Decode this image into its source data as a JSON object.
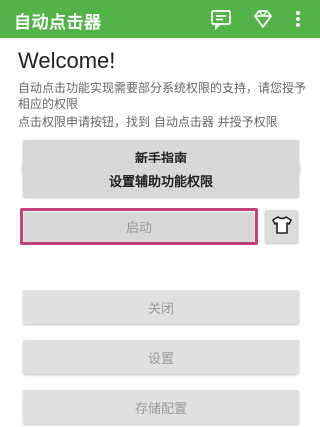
{
  "appbar": {
    "title": "自动点击器",
    "icons": [
      "message-icon",
      "diamond-icon",
      "more-vert-icon"
    ],
    "color": "#53b348"
  },
  "main": {
    "welcome": "Welcome!",
    "description_1": "自动点击功能实现需要部分系统权限的支持，请您授予相应的权限",
    "description_2": "点击权限申请按钮，找到 自动点击器 并授予权限",
    "buttons": {
      "guide": "新手指南",
      "accessibility": "设置辅助功能权限",
      "start": "启动",
      "close": "关闭",
      "settings": "设置",
      "storage": "存储配置"
    },
    "shirt_icon": "tshirt-icon",
    "highlight_color": "#c8407c"
  }
}
